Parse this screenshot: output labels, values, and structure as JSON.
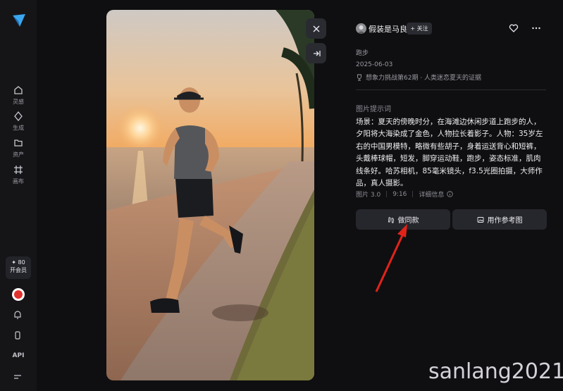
{
  "sidebar": {
    "items": [
      {
        "label": "灵感",
        "icon": "home-icon"
      },
      {
        "label": "生成",
        "icon": "sparkle-icon"
      },
      {
        "label": "资产",
        "icon": "folder-icon"
      },
      {
        "label": "画布",
        "icon": "canvas-icon"
      }
    ],
    "vip_points": "✦ 80",
    "vip_label": "开会员",
    "api_label": "API"
  },
  "author": {
    "name": "假装是马良",
    "follow_label": "+ 关注"
  },
  "post": {
    "tag": "跑步",
    "date": "2025-06-03",
    "event": "想象力挑战第62期 · 人类迷恋夏天的证据"
  },
  "prompt": {
    "heading": "图片提示词",
    "text": "场景：夏天的傍晚时分，在海滩边休闲步道上跑步的人，夕阳将大海染成了金色，人物拉长着影子。人物：35岁左右的中国男模特，略微有些胡子，身着运送背心和短裤，头戴棒球帽，短发，脚穿运动鞋，跑步，姿态标准，肌肉线条好。哈苏相机，85毫米镜头，f3.5光圈拍摄，大师作品，真人摄影。"
  },
  "meta": {
    "model": "图片 3.0",
    "ratio": "9:16",
    "details": "详细信息"
  },
  "actions": {
    "same_label": "做同款",
    "reference_label": "用作参考图"
  },
  "watermark": "sanlang2021",
  "colors": {
    "background": "#0f0f11",
    "sidebar": "#151518",
    "button": "#26272c",
    "arrow": "#e2231a",
    "logo": "#3aa7f0"
  }
}
